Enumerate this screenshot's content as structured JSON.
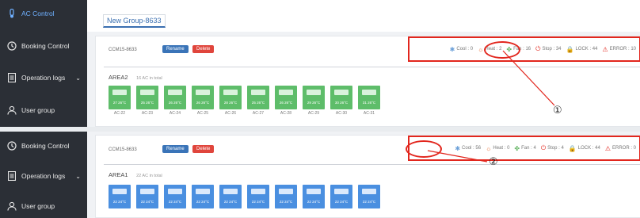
{
  "sidebar_top": {
    "items": [
      {
        "label": "AC Control",
        "icon": "thermometer-icon"
      },
      {
        "label": "Booking Control",
        "icon": "clock-icon"
      },
      {
        "label": "Operation logs",
        "icon": "document-icon",
        "chevron": "⌄"
      },
      {
        "label": "User group",
        "icon": "user-icon"
      }
    ]
  },
  "sidebar_bottom": {
    "items": [
      {
        "label": "Booking Control",
        "icon": "clock-icon"
      },
      {
        "label": "Operation logs",
        "icon": "document-icon",
        "chevron": "⌄"
      },
      {
        "label": "User group",
        "icon": "user-icon"
      }
    ]
  },
  "tab": {
    "label": "New Group-8633"
  },
  "panel1": {
    "title": "CCM15-8633",
    "rename": "Rename",
    "delete": "Delete",
    "status": [
      {
        "text": "Cool : 0",
        "icon": "snowflake-icon",
        "color": "#6a9fd8"
      },
      {
        "text": "Heat : 2",
        "icon": "sun-icon",
        "color": "#e8743c"
      },
      {
        "text": "Fan : 16",
        "icon": "fan-icon",
        "color": "#6ab86a"
      },
      {
        "text": "Stop : 34",
        "icon": "power-icon",
        "color": "#e2261d"
      },
      {
        "text": "LOCK : 44",
        "icon": "lock-icon",
        "color": "#e8a33c"
      },
      {
        "text": "ERROR : 10",
        "icon": "warning-icon",
        "color": "#e2261d"
      }
    ],
    "area_name": "AREA2",
    "area_count": "16 AC in total",
    "units": [
      {
        "label": "AC-22",
        "temp": "27 26°C"
      },
      {
        "label": "AC-23",
        "temp": "25 26°C"
      },
      {
        "label": "AC-24",
        "temp": "26 26°C"
      },
      {
        "label": "AC-25",
        "temp": "26 26°C"
      },
      {
        "label": "AC-26",
        "temp": "28 26°C"
      },
      {
        "label": "AC-27",
        "temp": "25 26°C"
      },
      {
        "label": "AC-28",
        "temp": "26 26°C"
      },
      {
        "label": "AC-29",
        "temp": "29 26°C"
      },
      {
        "label": "AC-30",
        "temp": "30 26°C"
      },
      {
        "label": "AC-31",
        "temp": "31 26°C"
      }
    ]
  },
  "panel2": {
    "title": "CCM15-8633",
    "rename": "Rename",
    "delete": "Delete",
    "status": [
      {
        "text": "Cool : 56",
        "icon": "snowflake-icon",
        "color": "#6a9fd8"
      },
      {
        "text": "Heat : 0",
        "icon": "sun-icon",
        "color": "#e8743c"
      },
      {
        "text": "Fan : 4",
        "icon": "fan-icon",
        "color": "#6ab86a"
      },
      {
        "text": "Stop : 4",
        "icon": "power-icon",
        "color": "#e2261d"
      },
      {
        "text": "LOCK : 44",
        "icon": "lock-icon",
        "color": "#e8a33c"
      },
      {
        "text": "ERROR : 0",
        "icon": "warning-icon",
        "color": "#e2261d"
      }
    ],
    "area_name": "AREA1",
    "area_count": "22 AC in total",
    "units": [
      {
        "temp": "22 24°C"
      },
      {
        "temp": "22 24°C"
      },
      {
        "temp": "22 24°C"
      },
      {
        "temp": "22 24°C"
      },
      {
        "temp": "22 24°C"
      },
      {
        "temp": "22 24°C"
      },
      {
        "temp": "22 24°C"
      },
      {
        "temp": "22 24°C"
      },
      {
        "temp": "22 24°C"
      },
      {
        "temp": "22 24°C"
      }
    ]
  },
  "callouts": {
    "one": "①",
    "two": "②"
  }
}
